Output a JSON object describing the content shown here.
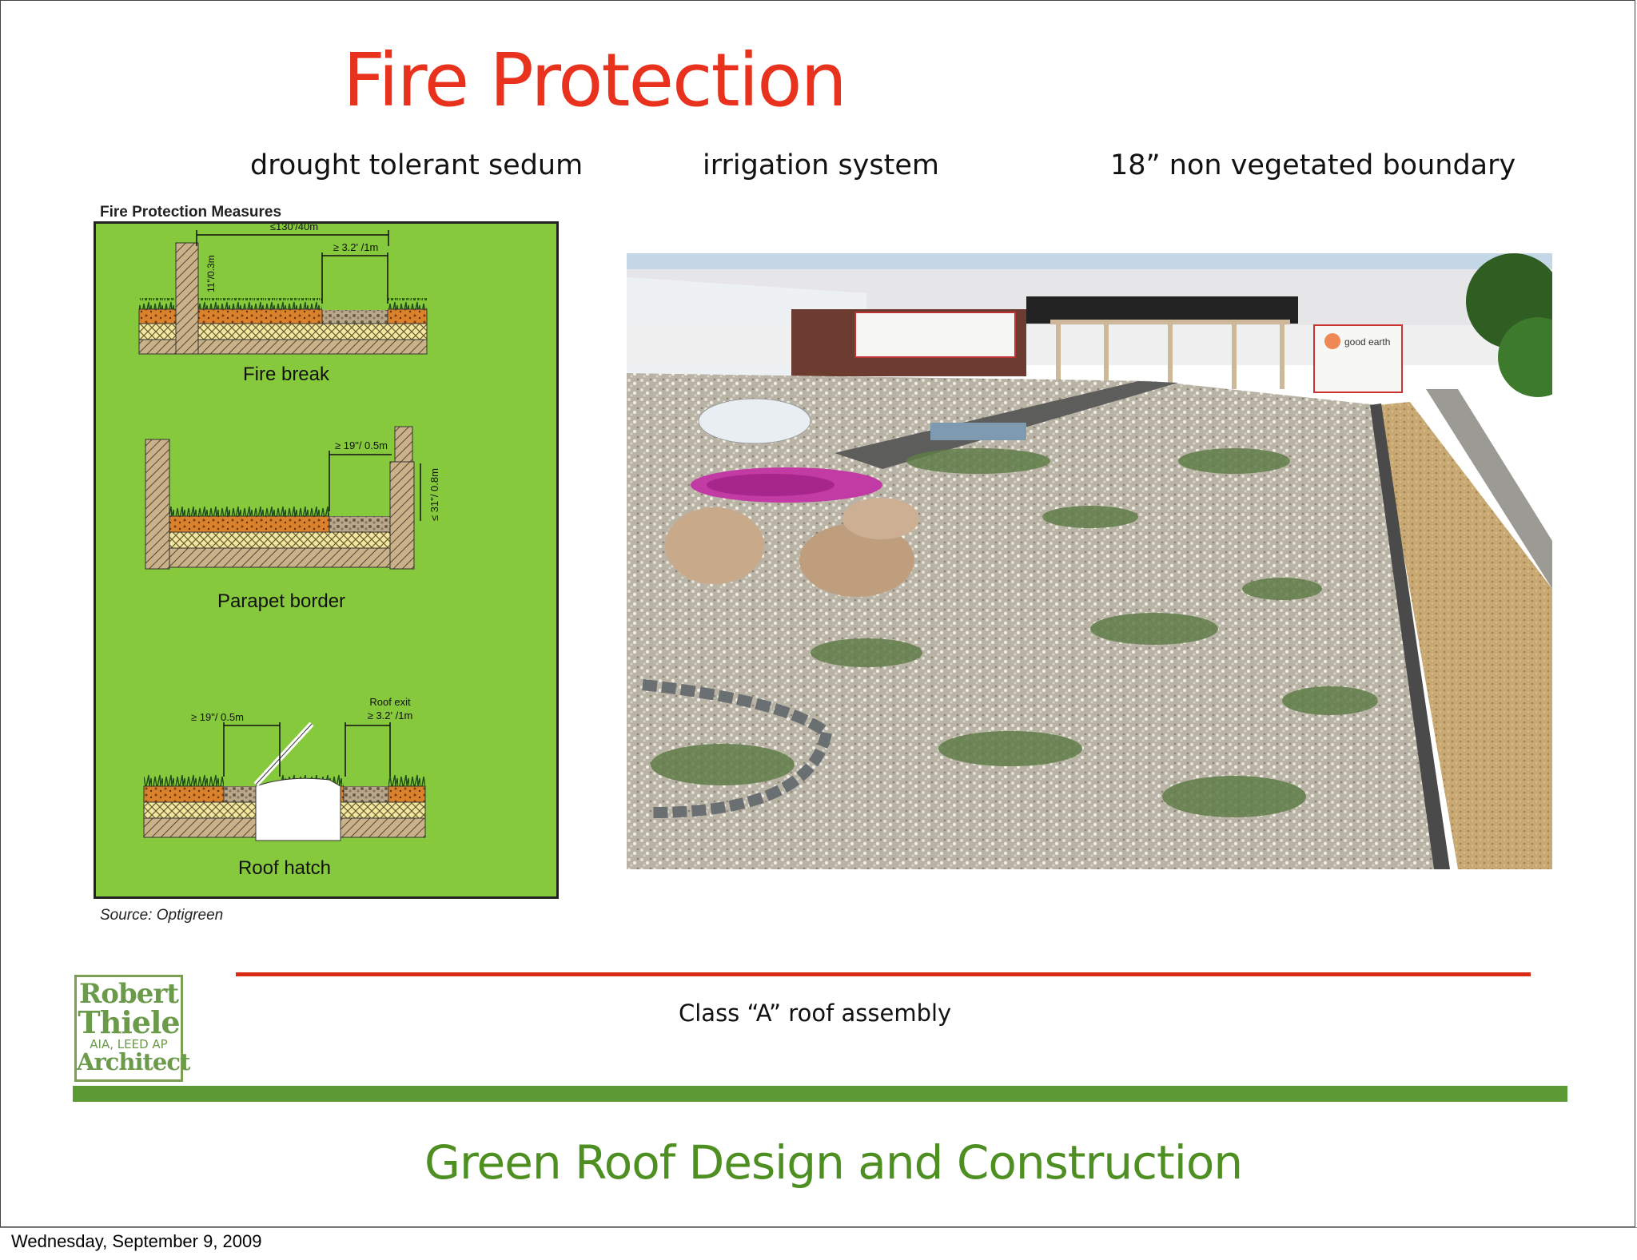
{
  "slide": {
    "title": "Fire Protection",
    "subheads": {
      "left": "drought tolerant sedum",
      "middle": "irrigation system",
      "right": "18” non vegetated boundary"
    },
    "diagram": {
      "heading": "Fire Protection Measures",
      "fire_break": {
        "label": "Fire break",
        "dim_width": "≤130'/40m",
        "dim_height": "11\"/0.3m",
        "dim_gap": "≥ 3.2' /1m"
      },
      "parapet_border": {
        "label": "Parapet border",
        "dim_gap": "≥ 19\"/ 0.5m",
        "dim_height": "≤ 31\"/ 0.8m"
      },
      "roof_hatch": {
        "label": "Roof hatch",
        "dim_gap": "≥ 19\"/ 0.5m",
        "dim_exit_label": "Roof exit",
        "dim_exit": "≥ 3.2' /1m"
      },
      "source": "Source: Optigreen"
    },
    "photo": {
      "sign_text": "good earth"
    },
    "caption": "Class “A” roof assembly",
    "logo": {
      "line1": "Robert",
      "line2": "Thiele",
      "line3": "AIA, LEED AP",
      "line4": "Architect"
    },
    "footer_title": "Green Roof Design and Construction"
  },
  "footer": {
    "date": "Wednesday, September 9, 2009"
  },
  "colors": {
    "title": "#e8321e",
    "footer_title": "#4e8f22",
    "red_rule": "#d92a14",
    "green_rule": "#5b9a34",
    "diagram_bg": "#86c93d"
  }
}
